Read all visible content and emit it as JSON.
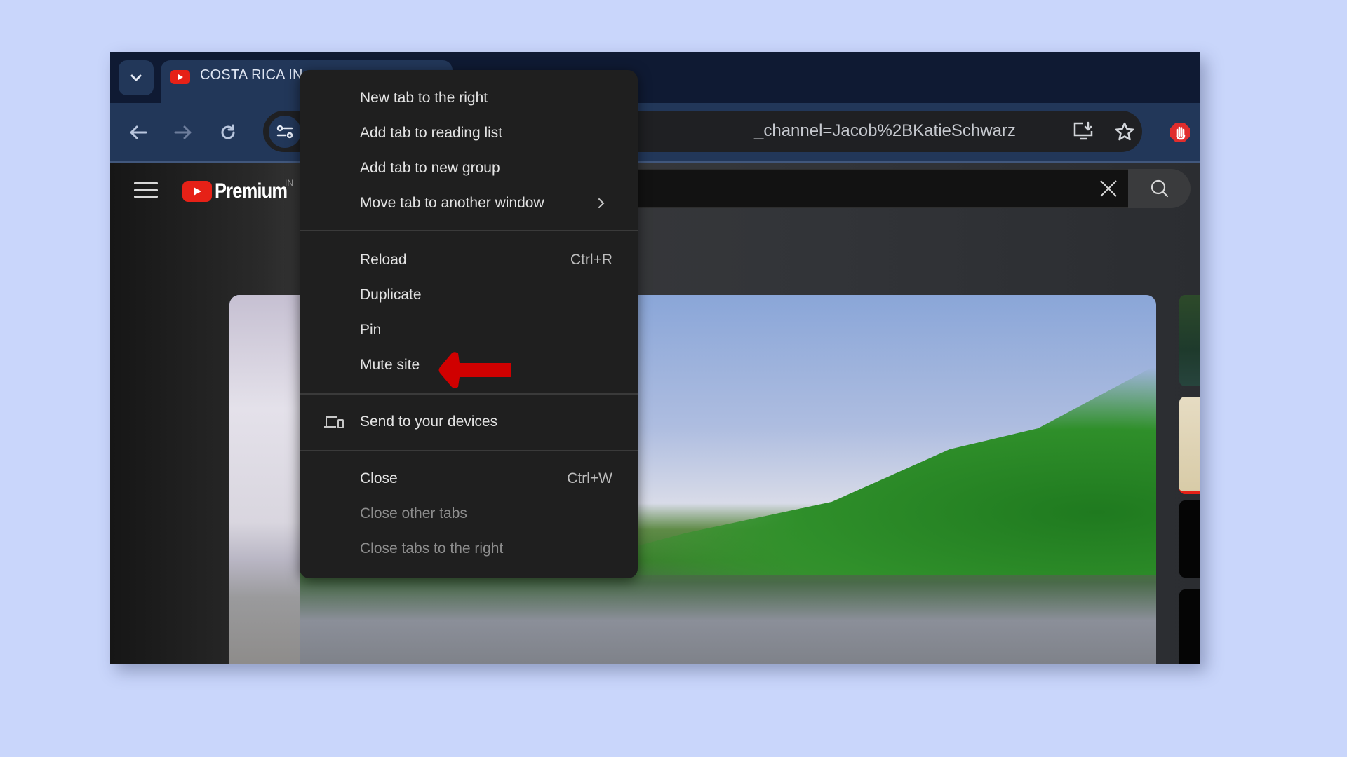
{
  "browser": {
    "tab": {
      "title": "COSTA RICA IN",
      "favicon": "youtube-icon"
    },
    "tab_search_icon": "chevron-down-icon",
    "toolbar": {
      "back": "back-arrow-icon",
      "forward": "forward-arrow-icon",
      "reload": "reload-icon",
      "site_info": "tune-icon"
    },
    "omnibox": {
      "url": "_channel=Jacob%2BKatieSchwarz",
      "install_icon": "install-app-icon",
      "bookmark_icon": "star-icon"
    },
    "extension_icon": "adblock-hand-icon"
  },
  "youtube": {
    "logo_text": "Premium",
    "region": "IN",
    "search_value": "",
    "clear_icon": "close-icon",
    "search_icon": "search-icon"
  },
  "context_menu": {
    "groups": [
      [
        {
          "label": "New tab to the right"
        },
        {
          "label": "Add tab to reading list"
        },
        {
          "label": "Add tab to new group"
        },
        {
          "label": "Move tab to another window",
          "submenu": true
        }
      ],
      [
        {
          "label": "Reload",
          "shortcut": "Ctrl+R"
        },
        {
          "label": "Duplicate"
        },
        {
          "label": "Pin"
        },
        {
          "label": "Mute site"
        }
      ],
      [
        {
          "label": "Send to your devices",
          "icon": "devices-icon"
        }
      ],
      [
        {
          "label": "Close",
          "shortcut": "Ctrl+W"
        },
        {
          "label": "Close other tabs",
          "disabled": true
        },
        {
          "label": "Close tabs to the right",
          "disabled": true
        }
      ]
    ]
  },
  "annotation": {
    "type": "arrow",
    "points_to": "Mute site",
    "color": "#d00000"
  },
  "colors": {
    "page_bg": "#c9d6fb",
    "tabbar": "#0f1a33",
    "toolbar": "#223759",
    "menu_bg": "#1f1f1f",
    "youtube_red": "#e62117"
  }
}
